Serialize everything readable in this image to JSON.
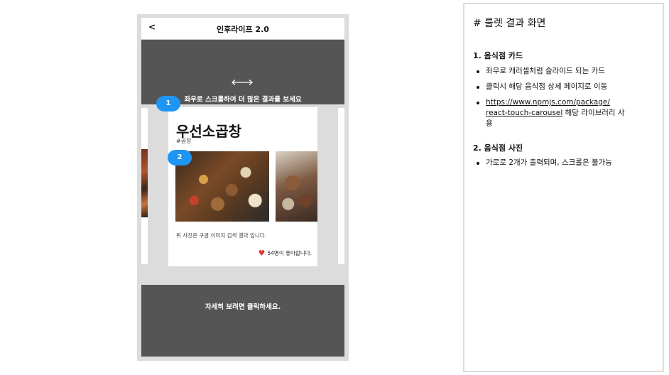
{
  "phone": {
    "back_label": "<",
    "app_title": "인후라이프 2.0",
    "swipe_hint": "좌우로 스크롤하여 더 많은 결과를 보세요",
    "detail_hint": "자세히 보려면 클릭하세요.",
    "card": {
      "name": "우선소곱창",
      "tag": "#곱창",
      "image_caption": "위 사진은 구글 이미지 검색 결과 입니다.",
      "likes": "54명이 좋아합니다."
    },
    "badges": [
      "1",
      "2"
    ],
    "colors": {
      "background": "#555555",
      "badge": "#1e95f2",
      "heart": "#e53935"
    },
    "icons": [
      "left-right-arrow-icon",
      "heart-icon"
    ]
  },
  "spec": {
    "heading": "# 룰렛 결과 화면",
    "sections": [
      {
        "title": "1. 음식점 카드",
        "bullets": [
          "좌우로 캐러셀처럼 슬라이드 되는 카드",
          "클릭시 해당 음식점 상세 페이지로 이동"
        ],
        "link_bullet": {
          "link_line1": "https://www.npmjs.com/package/",
          "link_line2": "react-touch-carousel",
          "suffix": " 해당 라이브러리 사",
          "continuation": "용"
        }
      },
      {
        "title": "2. 음식점 사진",
        "bullets": [
          "가로로 2개가 출력되며, 스크롤은 불가능"
        ]
      }
    ]
  }
}
